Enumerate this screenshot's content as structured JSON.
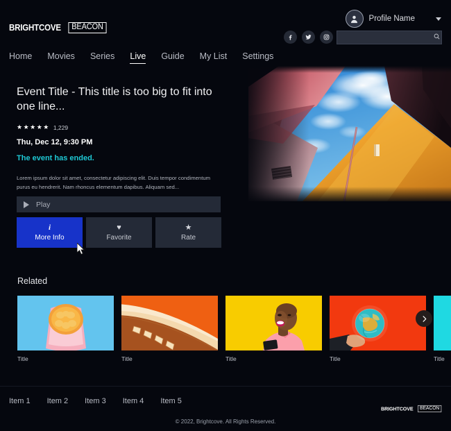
{
  "header": {
    "logo": {
      "word": "BRIGHTCOVE",
      "box": "BEACON"
    },
    "profile": {
      "name": "Profile Name",
      "caret_icon": "chevron-down-icon",
      "avatar_icon": "user-avatar-icon"
    },
    "social": [
      {
        "name": "facebook-icon",
        "label": "f"
      },
      {
        "name": "twitter-icon",
        "label": "t"
      },
      {
        "name": "instagram-icon",
        "label": "ig"
      }
    ],
    "search": {
      "value": "",
      "placeholder": "",
      "icon": "search-icon"
    },
    "nav": [
      {
        "label": "Home",
        "active": false
      },
      {
        "label": "Movies",
        "active": false
      },
      {
        "label": "Series",
        "active": false
      },
      {
        "label": "Live",
        "active": true
      },
      {
        "label": "Guide",
        "active": false
      },
      {
        "label": "My List",
        "active": false
      },
      {
        "label": "Settings",
        "active": false
      }
    ]
  },
  "detail": {
    "title": "Event Title - This title is too big to fit into one line...",
    "stars": "★★★★★",
    "rating_count": "1,229",
    "datetime": "Thu, Dec 12, 9:30 PM",
    "status": "The event has ended.",
    "status_color": "#1ec8d4",
    "description": "Lorem ipsum dolor sit amet, consectetur adipiscing elit. Duis tempor condimentum purus eu hendrerit. Nam rhoncus elementum dapibus. Aliquam sed..."
  },
  "buttons": {
    "play": {
      "label": "Play",
      "icon": "play-triangle-icon"
    },
    "actions": [
      {
        "label": "More Info",
        "icon": "info-icon",
        "glyph": "i",
        "selected": true,
        "accent": "#1733c9"
      },
      {
        "label": "Favorite",
        "icon": "heart-icon",
        "glyph": "♥",
        "selected": false
      },
      {
        "label": "Rate",
        "icon": "star-icon",
        "glyph": "★",
        "selected": false
      }
    ]
  },
  "related": {
    "heading": "Related",
    "next_icon": "chevron-right-icon",
    "cards": [
      {
        "label": "Title",
        "theme": "orange-slice-blue"
      },
      {
        "label": "Title",
        "theme": "orange-arch"
      },
      {
        "label": "Title",
        "theme": "yellow-portrait"
      },
      {
        "label": "Title",
        "theme": "red-globe"
      },
      {
        "label": "Title",
        "theme": "cyan"
      }
    ]
  },
  "footer": {
    "links": [
      "Item 1",
      "Item 2",
      "Item 3",
      "Item 4",
      "Item 5"
    ],
    "logo": {
      "word": "BRIGHTCOVE",
      "box": "BEACON"
    },
    "copyright": "© 2022, Brightcove. All Rights Reserved."
  }
}
